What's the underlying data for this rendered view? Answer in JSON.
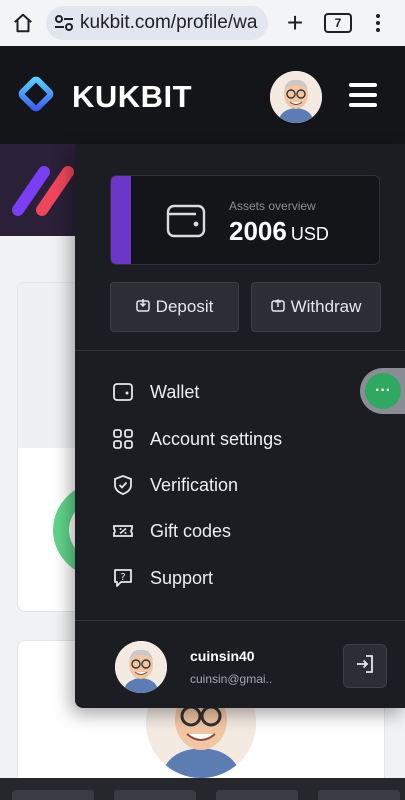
{
  "browser": {
    "url": "kukbit.com/profile/wa",
    "tab_count": "7"
  },
  "header": {
    "brand": "KUKBIT"
  },
  "dropdown": {
    "assets": {
      "label": "Assets overview",
      "amount": "2006",
      "currency": "USD"
    },
    "buttons": {
      "deposit": "Deposit",
      "withdraw": "Withdraw"
    },
    "menu": [
      {
        "label": "Wallet",
        "icon": "wallet-icon"
      },
      {
        "label": "Account settings",
        "icon": "grid-icon"
      },
      {
        "label": "Verification",
        "icon": "shield-check-icon"
      },
      {
        "label": "Gift codes",
        "icon": "ticket-icon"
      },
      {
        "label": "Support",
        "icon": "help-chat-icon"
      }
    ],
    "user": {
      "name": "cuinsin40",
      "email": "cuinsin@gmai.."
    }
  },
  "chat_widget": {
    "label": "···"
  },
  "colors": {
    "header_bg": "#131519",
    "panel_bg": "#1b1d22",
    "accent_purple": "#6a37c9",
    "chat_green": "#2fa862",
    "logo_blue": "#3b82f6"
  }
}
